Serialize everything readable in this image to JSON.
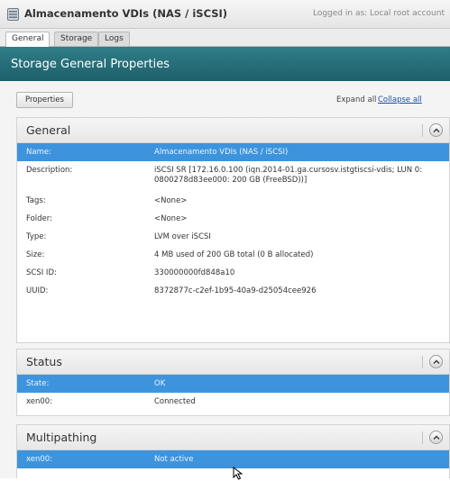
{
  "window": {
    "title": "Almacenamento VDIs (NAS / iSCSI)",
    "login_status": "Logged in as: Local root account"
  },
  "tabs": [
    {
      "label": "General",
      "active": true
    },
    {
      "label": "Storage",
      "active": false
    },
    {
      "label": "Logs",
      "active": false
    }
  ],
  "header": {
    "title": "Storage General Properties"
  },
  "toolbar": {
    "properties_label": "Properties",
    "expand_all_label": "Expand all",
    "collapse_all_label": "Collapse all"
  },
  "sections": {
    "general": {
      "title": "General",
      "rows": [
        {
          "key": "Name:",
          "value": "Almacenamento VDIs (NAS / iSCSI)",
          "selected": true
        },
        {
          "key": "Description:",
          "value": "iSCSI SR [172.16.0.100 (iqn.2014-01.ga.cursosv.istgtiscsi-vdis; LUN 0: 0800278d83ee000: 200 GB (FreeBSD))]"
        },
        {
          "key": "Tags:",
          "value": "<None>"
        },
        {
          "key": "Folder:",
          "value": "<None>"
        },
        {
          "key": "Type:",
          "value": "LVM over iSCSI"
        },
        {
          "key": "Size:",
          "value": "4 MB used of 200 GB total (0 B allocated)"
        },
        {
          "key": "SCSI ID:",
          "value": "330000000fd848a10"
        },
        {
          "key": "UUID:",
          "value": "8372877c-c2ef-1b95-40a9-d25054cee926"
        }
      ]
    },
    "status": {
      "title": "Status",
      "rows": [
        {
          "key": "State:",
          "value": "OK",
          "selected": true
        },
        {
          "key": "xen00:",
          "value": "Connected"
        }
      ]
    },
    "multipathing": {
      "title": "Multipathing",
      "rows": [
        {
          "key": "xen00:",
          "value": "Not active",
          "selected": true
        }
      ]
    }
  },
  "colors": {
    "header_teal": "#1e5f6a",
    "selection_blue": "#3d94dd",
    "link_blue": "#1a4fa3"
  },
  "icons": [
    "storage-repository-icon",
    "collapse-chevron-up-icon",
    "mouse-cursor-icon"
  ]
}
